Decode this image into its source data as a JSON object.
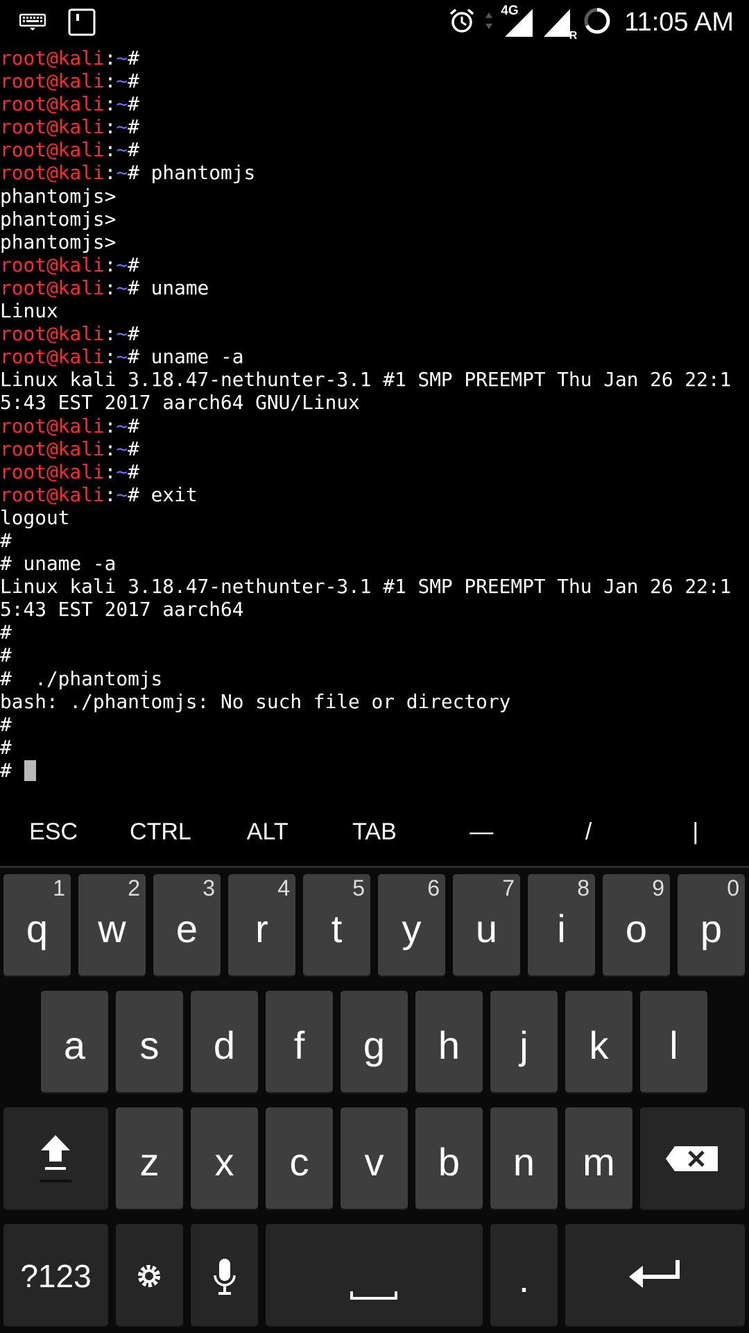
{
  "status_bar": {
    "time": "11:05 AM",
    "network_label": "4G",
    "roaming_label": "R",
    "icons": [
      "keyboard-icon",
      "screenshot-icon",
      "alarm-icon",
      "data-arrows-icon",
      "signal-4g-icon",
      "signal-roaming-icon",
      "battery-ring-icon"
    ]
  },
  "terminal": {
    "prompt_user": "root@kali",
    "prompt_sep": ":",
    "prompt_path": "~",
    "prompt_symbol": "#",
    "lines": [
      {
        "type": "prompt",
        "cmd": ""
      },
      {
        "type": "prompt",
        "cmd": ""
      },
      {
        "type": "prompt",
        "cmd": ""
      },
      {
        "type": "prompt",
        "cmd": ""
      },
      {
        "type": "prompt",
        "cmd": ""
      },
      {
        "type": "prompt",
        "cmd": " phantomjs"
      },
      {
        "type": "text",
        "text": "phantomjs>"
      },
      {
        "type": "text",
        "text": "phantomjs>"
      },
      {
        "type": "text",
        "text": "phantomjs>"
      },
      {
        "type": "prompt",
        "cmd": ""
      },
      {
        "type": "prompt",
        "cmd": " uname"
      },
      {
        "type": "text",
        "text": "Linux"
      },
      {
        "type": "prompt",
        "cmd": ""
      },
      {
        "type": "prompt",
        "cmd": " uname -a"
      },
      {
        "type": "text",
        "text": "Linux kali 3.18.47-nethunter-3.1 #1 SMP PREEMPT Thu Jan 26 22:1"
      },
      {
        "type": "text",
        "text": "5:43 EST 2017 aarch64 GNU/Linux"
      },
      {
        "type": "prompt",
        "cmd": ""
      },
      {
        "type": "prompt",
        "cmd": ""
      },
      {
        "type": "prompt",
        "cmd": ""
      },
      {
        "type": "prompt",
        "cmd": " exit"
      },
      {
        "type": "text",
        "text": "logout"
      },
      {
        "type": "text",
        "text": "#"
      },
      {
        "type": "text",
        "text": "# uname -a"
      },
      {
        "type": "text",
        "text": "Linux kali 3.18.47-nethunter-3.1 #1 SMP PREEMPT Thu Jan 26 22:1"
      },
      {
        "type": "text",
        "text": "5:43 EST 2017 aarch64"
      },
      {
        "type": "text",
        "text": "#"
      },
      {
        "type": "text",
        "text": "#"
      },
      {
        "type": "text",
        "text": "#  ./phantomjs"
      },
      {
        "type": "text",
        "text": "bash: ./phantomjs: No such file or directory"
      },
      {
        "type": "text",
        "text": "#"
      },
      {
        "type": "text",
        "text": "#"
      },
      {
        "type": "cursor",
        "text": "# "
      }
    ]
  },
  "extra_keys": [
    "ESC",
    "CTRL",
    "ALT",
    "TAB",
    "—",
    "/",
    "|"
  ],
  "keyboard": {
    "row1": [
      {
        "key": "q",
        "hint": "1"
      },
      {
        "key": "w",
        "hint": "2"
      },
      {
        "key": "e",
        "hint": "3"
      },
      {
        "key": "r",
        "hint": "4"
      },
      {
        "key": "t",
        "hint": "5"
      },
      {
        "key": "y",
        "hint": "6"
      },
      {
        "key": "u",
        "hint": "7"
      },
      {
        "key": "i",
        "hint": "8"
      },
      {
        "key": "o",
        "hint": "9"
      },
      {
        "key": "p",
        "hint": "0"
      }
    ],
    "row2": [
      "a",
      "s",
      "d",
      "f",
      "g",
      "h",
      "j",
      "k",
      "l"
    ],
    "row3": [
      "z",
      "x",
      "c",
      "v",
      "b",
      "n",
      "m"
    ],
    "symbols_label": "?123",
    "period_label": ".",
    "icons": [
      "shift-icon",
      "backspace-icon",
      "settings-icon",
      "mic-icon",
      "space-icon",
      "enter-icon"
    ]
  },
  "colors": {
    "user": "#ff2a2a",
    "path": "#6f6fff",
    "text": "#ffffff",
    "background": "#000000",
    "key": "#3e3e3e",
    "key_dark": "#262626"
  }
}
